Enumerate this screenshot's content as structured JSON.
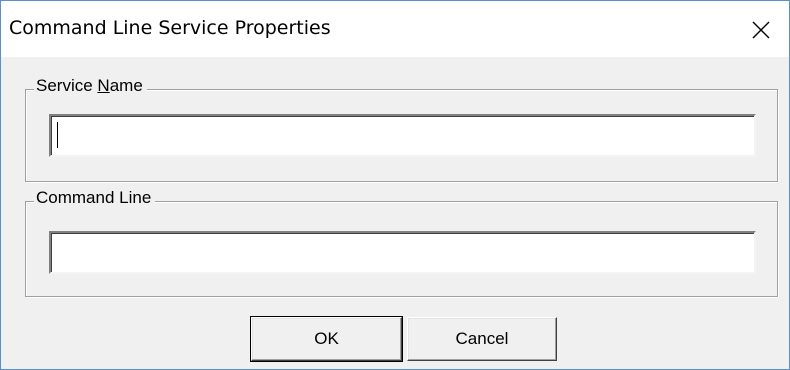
{
  "window": {
    "title": "Command Line Service Properties",
    "close_icon": "close-icon"
  },
  "service_name_group": {
    "label_prefix": "Service ",
    "label_mnemonic": "N",
    "label_suffix": "ame",
    "value": ""
  },
  "command_line_group": {
    "label": "Command Line",
    "value": ""
  },
  "buttons": {
    "ok_label": "OK",
    "cancel_label": "Cancel"
  },
  "colors": {
    "title_bar": "#ffffff",
    "dialog_background": "#f0f0f0",
    "window_border": "#5a8fcf",
    "group_border": "#a0a0a0"
  }
}
